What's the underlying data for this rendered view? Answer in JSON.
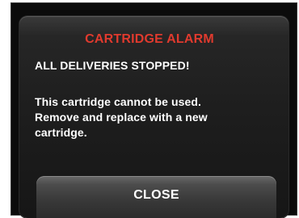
{
  "alarm": {
    "title": "CARTRIDGE ALARM",
    "subtitle": "ALL DELIVERIES STOPPED!",
    "message_line1": "This cartridge cannot be used.",
    "message_line2": "Remove and replace with a new",
    "message_line3": "cartridge.",
    "close_label": "CLOSE"
  },
  "colors": {
    "title": "#e03a2e",
    "text": "#ffffff",
    "background": "#0b0b0b",
    "button": "#4c4c4c"
  }
}
